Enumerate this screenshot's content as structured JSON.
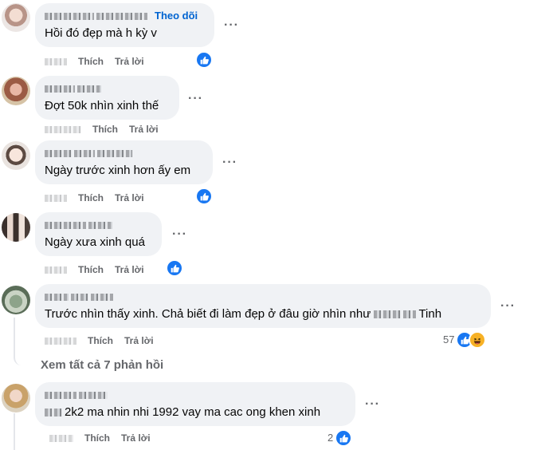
{
  "colors": {
    "accent": "#0064d1",
    "like_blue": "#1877f2",
    "bubble_bg": "#f0f2f5",
    "meta_gray": "#65676b"
  },
  "icons": {
    "more": "more-horizontal-icon",
    "like": "like-reaction-icon",
    "haha": "haha-reaction-icon"
  },
  "comments": [
    {
      "follow_label": "Theo dõi",
      "text": "Hồi đó đẹp mà h kỳ v",
      "like_label": "Thích",
      "reply_label": "Trả lời",
      "reactions": [
        "like"
      ]
    },
    {
      "text": "Đợt 50k nhìn xinh thế",
      "like_label": "Thích",
      "reply_label": "Trả lời",
      "reactions": []
    },
    {
      "text": "Ngày trước xinh hơn ấy em",
      "like_label": "Thích",
      "reply_label": "Trả lời",
      "reactions": [
        "like"
      ]
    },
    {
      "text": "Ngày xưa xinh quá",
      "like_label": "Thích",
      "reply_label": "Trả lời",
      "reactions": [
        "like"
      ]
    },
    {
      "text_start": "Trước nhìn thấy xinh. Chả biết đi làm đẹp ở đâu giờ nhìn như",
      "text_end": "Tinh",
      "like_label": "Thích",
      "reply_label": "Trả lời",
      "reaction_count": "57",
      "reactions": [
        "like",
        "haha"
      ]
    },
    {
      "text": "2k2 ma nhin nhi 1992 vay ma cac ong khen xinh",
      "like_label": "Thích",
      "reply_label": "Trả lời",
      "reaction_count": "2",
      "reactions": [
        "like"
      ]
    }
  ],
  "view_replies_label": "Xem tất cả 7 phản hồi"
}
